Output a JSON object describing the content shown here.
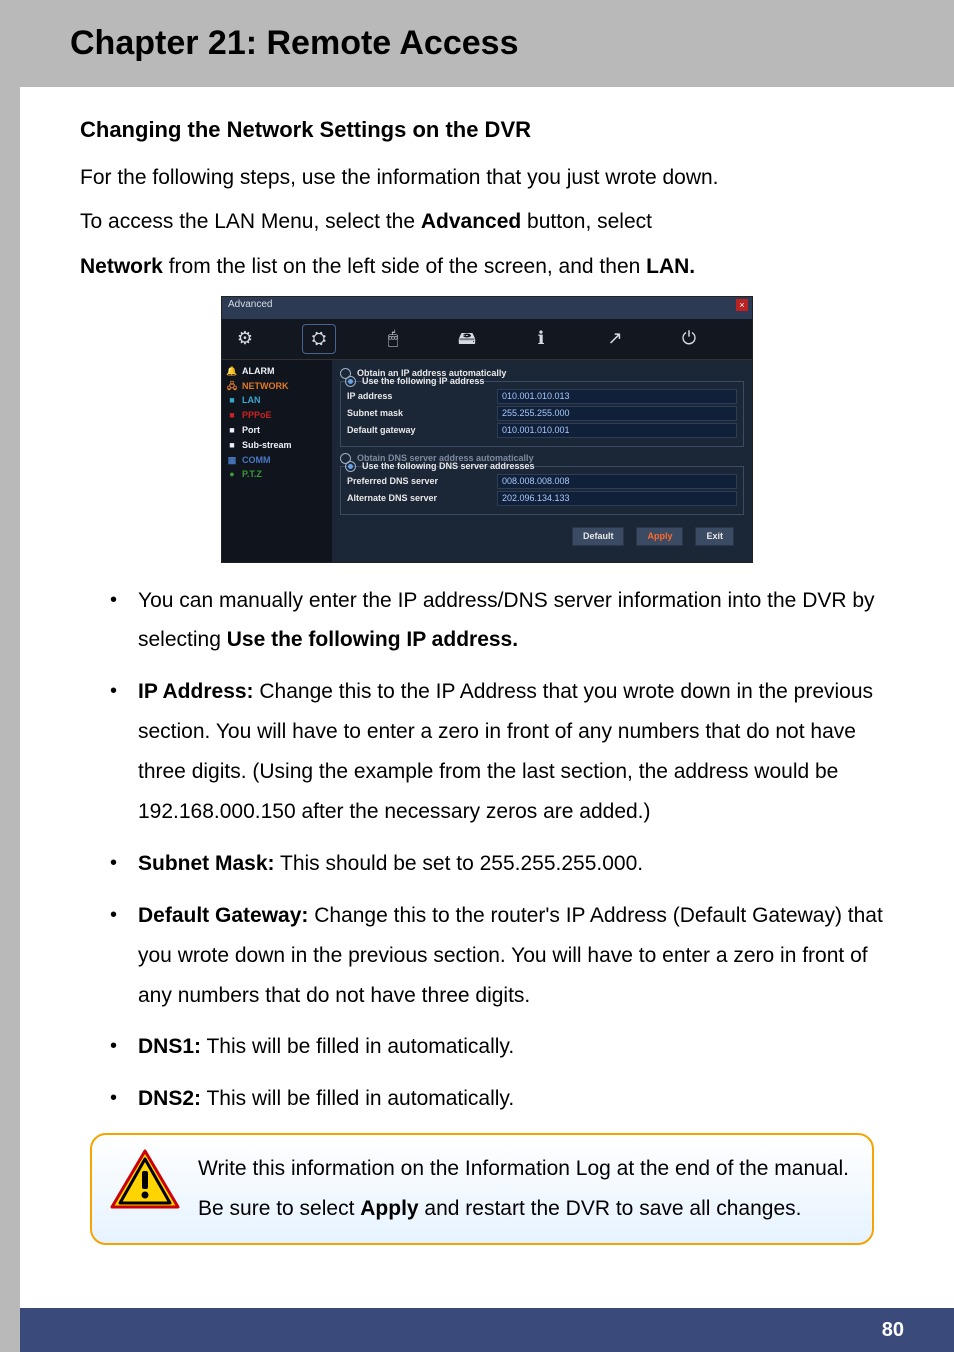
{
  "chapter_title": "Chapter 21: Remote Access",
  "section_heading": "Changing the Network Settings on the DVR",
  "intro_line": "For the following steps, use the information that you just wrote down.",
  "access_prefix": "To access the LAN Menu, select the ",
  "access_btn": "Advanced",
  "access_mid": " button, select ",
  "access_network": "Network",
  "access_tail": " from the list on the left side of the screen, and then ",
  "access_lan": "LAN.",
  "scr": {
    "title": "Advanced",
    "tabs": [
      "⚙",
      "⛭",
      "🖱",
      "🖴",
      "ℹ",
      "↗",
      "⏻"
    ],
    "side": [
      {
        "icon": "🔔",
        "label": "ALARM",
        "cls": "c-white"
      },
      {
        "icon": "🖧",
        "label": "NETWORK",
        "cls": "c-orange"
      },
      {
        "icon": "■",
        "label": "LAN",
        "cls": "c-cyan"
      },
      {
        "icon": "■",
        "label": "PPPoE",
        "cls": "c-red"
      },
      {
        "icon": "■",
        "label": "Port",
        "cls": "c-white"
      },
      {
        "icon": "■",
        "label": "Sub-stream",
        "cls": "c-white"
      },
      {
        "icon": "▦",
        "label": "COMM",
        "cls": "c-blue"
      },
      {
        "icon": "●",
        "label": "P.T.Z",
        "cls": "c-green"
      }
    ],
    "ip_auto": "Obtain an IP address automatically",
    "ip_use": "Use the following IP address",
    "fields_ip": [
      {
        "label": "IP address",
        "value": "010.001.010.013"
      },
      {
        "label": "Subnet mask",
        "value": "255.255.255.000"
      },
      {
        "label": "Default gateway",
        "value": "010.001.010.001"
      }
    ],
    "dns_auto": "Obtain DNS server address automatically",
    "dns_use": "Use the following DNS server addresses",
    "fields_dns": [
      {
        "label": "Preferred DNS server",
        "value": "008.008.008.008"
      },
      {
        "label": "Alternate DNS server",
        "value": "202.096.134.133"
      }
    ],
    "btn_default": "Default",
    "btn_apply": "Apply",
    "btn_exit": "Exit"
  },
  "bullets": {
    "b1a": "You can manually enter the IP address/DNS server information into the DVR by selecting ",
    "b1b": "Use the following IP address.",
    "b2l": "IP Address:",
    "b2t": " Change this to the IP Address that you wrote down in the previous section. You will have to enter a zero in front of any numbers that do not have three digits. (Using the example from the last section, the address would be 192.168.000.150 after the necessary zeros are added.)",
    "b3l": "Subnet Mask:",
    "b3t": " This should be set to 255.255.255.000.",
    "b4l": "Default Gateway:",
    "b4t": " Change this to the router's IP Address (Default Gateway) that you wrote down in the previous section. You will have to enter a zero in front of any numbers that do not have three digits.",
    "b5l": "DNS1:",
    "b5t": " This will be filled in automatically.",
    "b6l": "DNS2:",
    "b6t": " This will be filled in automatically."
  },
  "note": {
    "a": "Write this information on the Information Log at the end of the manual. Be sure to select ",
    "b": "Apply",
    "c": " and restart the DVR to save all changes."
  },
  "page_number": "80"
}
